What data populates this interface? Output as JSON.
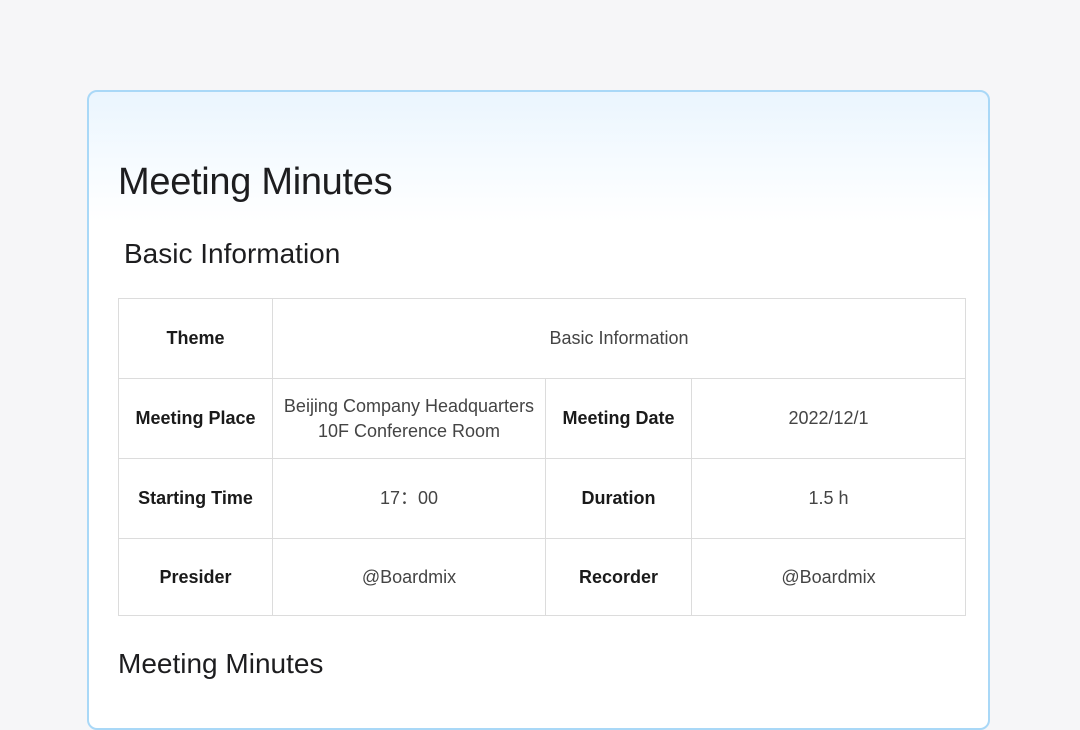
{
  "document": {
    "title": "Meeting Minutes",
    "sections": {
      "basic_info_heading": "Basic Information",
      "minutes_heading": "Meeting Minutes"
    }
  },
  "info_table": {
    "theme": {
      "label": "Theme",
      "value": "Basic Information"
    },
    "meeting_place": {
      "label": "Meeting Place",
      "value_line1": "Beijing Company Headquarters",
      "value_line2": "10F Conference Room"
    },
    "meeting_date": {
      "label": "Meeting Date",
      "value": "2022/12/1"
    },
    "starting_time": {
      "label": "Starting Time",
      "value": "17：00"
    },
    "duration": {
      "label": "Duration",
      "value": "1.5 h"
    },
    "presider": {
      "label": "Presider",
      "value": "@Boardmix"
    },
    "recorder": {
      "label": "Recorder",
      "value": "@Boardmix"
    }
  },
  "colors": {
    "background": "#f6f6f8",
    "card_border": "#a9d8f7",
    "card_header_tint": "#eaf5fe",
    "table_border": "#dcdcdc"
  }
}
